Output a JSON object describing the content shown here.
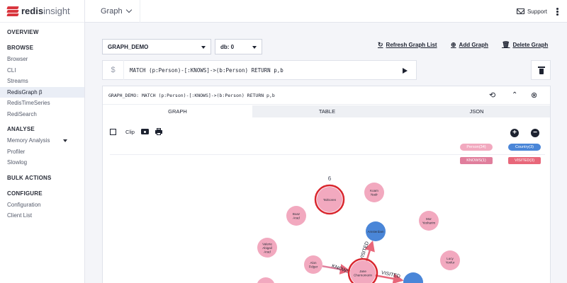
{
  "app": {
    "brand_bold": "redis",
    "brand_light": "insight"
  },
  "sidebar": {
    "sections": [
      {
        "title": "OVERVIEW",
        "items": []
      },
      {
        "title": "BROWSE",
        "items": [
          "Browser",
          "CLI",
          "Streams",
          "RedisGraph β",
          "RedisTimeSeries",
          "RediSearch"
        ]
      },
      {
        "title": "ANALYSE",
        "items": [
          "Memory Analysis",
          "Profiler",
          "Slowlog"
        ]
      },
      {
        "title": "BULK ACTIONS",
        "items": []
      },
      {
        "title": "CONFIGURE",
        "items": [
          "Configuration",
          "Client List"
        ]
      }
    ],
    "active_item": "RedisGraph β"
  },
  "topbar": {
    "module": "Graph",
    "support": "Support"
  },
  "controls": {
    "graph_select": "GRAPH_DEMO",
    "db_select": "db: 0",
    "refresh": "Refresh Graph List",
    "add": "Add Graph",
    "delete": "Delete Graph"
  },
  "query": {
    "prompt": "$",
    "text": "MATCH (p:Person)-[:KNOWS]->(b:Person) RETURN p,b"
  },
  "result": {
    "header": "GRAPH_DEMO: MATCH (p:Person)-[:KNOWS]->(b:Person) RETURN p,b",
    "tabs": [
      "GRAPH",
      "TABLE",
      "JSON"
    ],
    "clip_label": "Clip",
    "legend": [
      {
        "label": "Person(34)",
        "color": "#f2a9bf"
      },
      {
        "label": "Country(3)",
        "color": "#4a86d8"
      },
      {
        "label": "KNOWS(1)",
        "color": "#e07e9c"
      },
      {
        "label": "VISITED(3)",
        "color": "#e8677a"
      }
    ],
    "graph": {
      "top_label": "6",
      "nodes": [
        {
          "label": "TalGoren",
          "color": "#f2a9bf",
          "highlight": true
        },
        {
          "label": "Koam Nadr",
          "color": "#f2a9bf"
        },
        {
          "label": "Boaz Arad",
          "color": "#f2a9bf"
        },
        {
          "label": "Mor Yesharim",
          "color": "#f2a9bf"
        },
        {
          "label": "Valerie Abigail Arad",
          "color": "#f2a9bf"
        },
        {
          "label": "Amsterdam",
          "color": "#4a86d8"
        },
        {
          "label": "Alon Fidger",
          "color": "#f2a9bf"
        },
        {
          "label": "Jane Chernomorin",
          "color": "#f2a9bf",
          "highlight": true
        },
        {
          "label": "Lucy Yonfur",
          "color": "#f2a9bf"
        },
        {
          "label": "",
          "color": "#4a86d8"
        },
        {
          "label": "",
          "color": "#f2a9bf"
        }
      ],
      "edges": [
        {
          "label": "KNOWS"
        },
        {
          "label": "VISITED"
        },
        {
          "label": "VISITED"
        }
      ]
    }
  }
}
